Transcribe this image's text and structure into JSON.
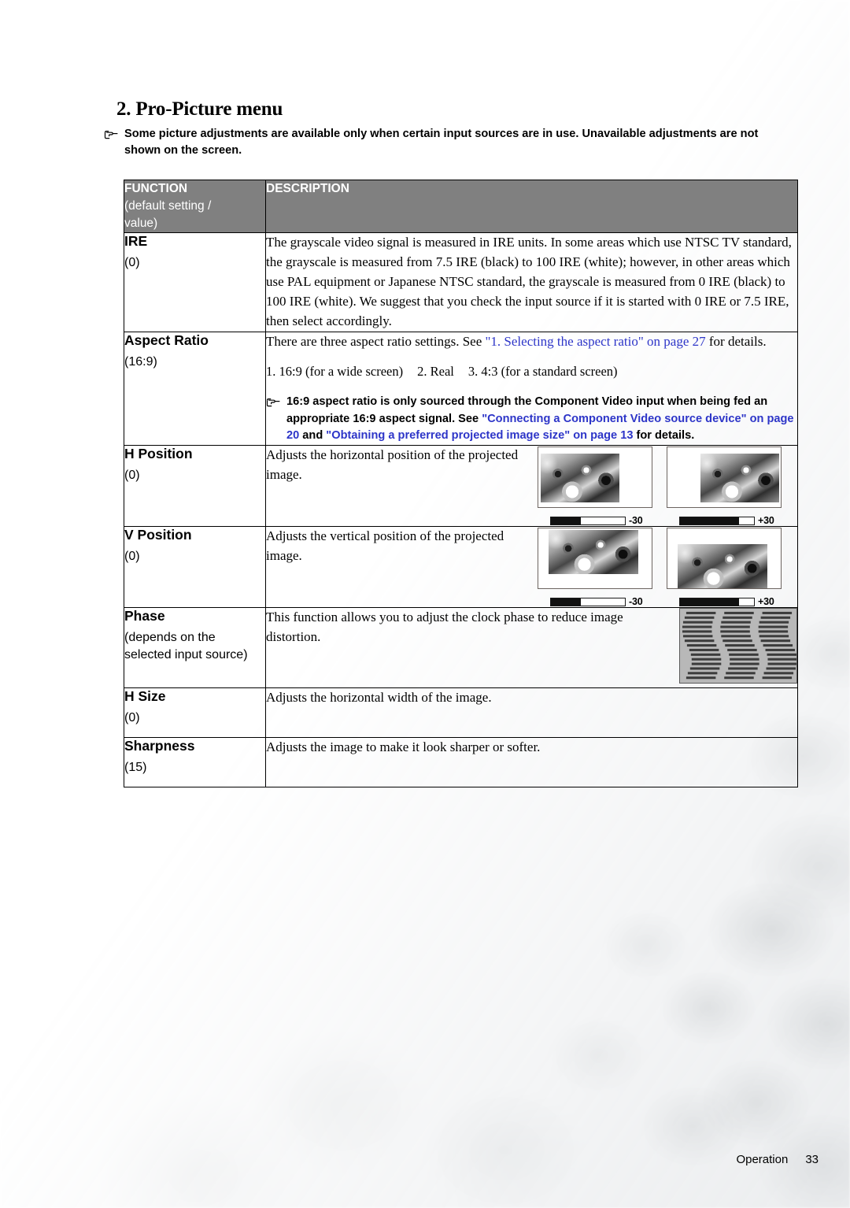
{
  "page": {
    "title": "2. Pro-Picture menu",
    "footer_label": "Operation",
    "footer_page": "33"
  },
  "top_note": {
    "icon": "pointing-hand-icon",
    "text": "Some picture adjustments are available only when certain input sources are in use. Unavailable adjustments are not shown on the screen."
  },
  "table": {
    "headers": {
      "function_title": "FUNCTION",
      "function_sub": "(default setting / value)",
      "description": "DESCRIPTION"
    },
    "rows": [
      {
        "name": "IRE",
        "default": "(0)",
        "description": "The grayscale video signal is measured in IRE units. In some areas which use NTSC TV standard, the grayscale is measured from 7.5 IRE (black) to 100 IRE (white); however, in other areas which use PAL equipment or Japanese NTSC standard, the grayscale is measured from 0 IRE (black) to 100 IRE (white). We suggest that you check the input source if it is started with 0 IRE or 7.5 IRE, then select accordingly."
      },
      {
        "name": "Aspect Ratio",
        "default": "(16:9)",
        "description_pre": "There are three aspect ratio settings. See ",
        "description_link": "\"1. Selecting the aspect ratio\" on page 27",
        "description_post": " for details.",
        "options": [
          "1. 16:9 (for a wide screen)",
          "2. Real",
          "3. 4:3 (for a standard screen)"
        ],
        "note_icon": "pointing-hand-icon",
        "note_part1": "16:9 aspect ratio is only sourced through the Component Video input when being fed an appropriate 16:9 aspect signal. See ",
        "note_link1": "\"Connecting a Component Video source device\" on page 20",
        "note_part2": " and ",
        "note_link2": "\"Obtaining a preferred projected image size\" on page 13",
        "note_part3": " for details."
      },
      {
        "name": "H Position",
        "default": "(0)",
        "description": "Adjusts the horizontal position of the projected image.",
        "thumbnails": [
          {
            "label": "-30",
            "fill_percent": 40
          },
          {
            "label": "+30",
            "fill_percent": 80
          }
        ]
      },
      {
        "name": "V Position",
        "default": "(0)",
        "description": "Adjusts the vertical position of the projected image.",
        "thumbnails": [
          {
            "label": "-30",
            "fill_percent": 40
          },
          {
            "label": "+30",
            "fill_percent": 80
          }
        ]
      },
      {
        "name": "Phase",
        "default": "(depends on the selected input source)",
        "description": "This function allows you to adjust the clock phase to reduce image distortion.",
        "pattern": "chevron-stripe-pattern"
      },
      {
        "name": "H Size",
        "default": "(0)",
        "description": "Adjusts the horizontal width of the image."
      },
      {
        "name": "Sharpness",
        "default": "(15)",
        "description": "Adjusts the image to make it look sharper or softer."
      }
    ]
  },
  "colors": {
    "header_bg": "#808080",
    "link": "#2d35c8",
    "text": "#000000"
  }
}
